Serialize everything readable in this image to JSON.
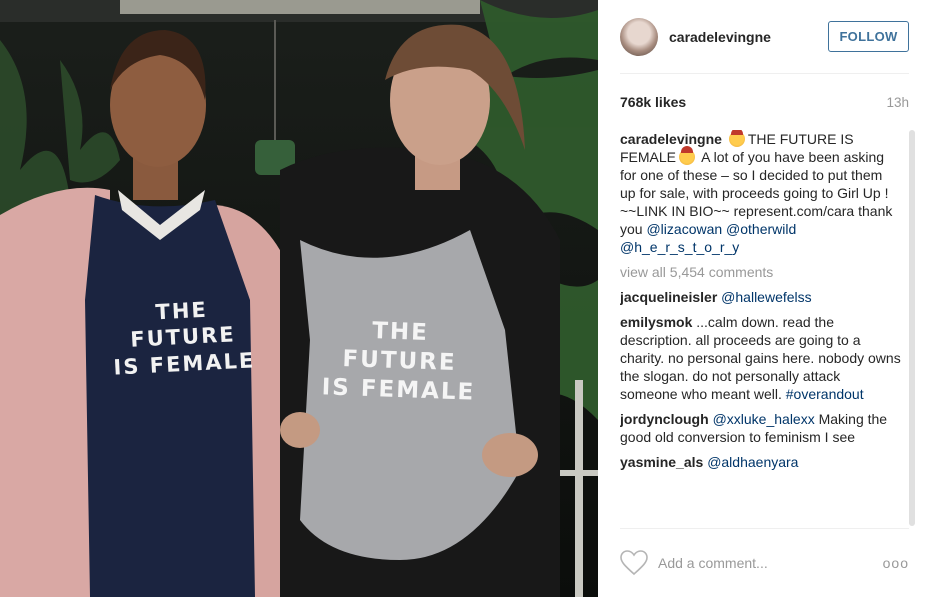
{
  "post": {
    "username": "caradelevingne",
    "follow_label": "FOLLOW",
    "likes": "768k likes",
    "time": "13h",
    "shirt_left": "THE FUTURE\nIS FEMALE",
    "shirt_right": "THE FUTURE\nIS FEMALE"
  },
  "caption": {
    "user": "caradelevingne",
    "text_1": "THE FUTURE IS FEMALE",
    "text_2": "A lot of you have been asking for one of these – so I decided to put them up for sale, with proceeds going to Girl Up ! ~~LINK IN BIO~~ represent.com/cara thank you",
    "mention_1": "@lizacowan",
    "mention_2": "@otherwild",
    "mention_3": "@h_e_r_s_t_o_r_y"
  },
  "view_all": "view all 5,454 comments",
  "comments": [
    {
      "user": "jacquelineisler",
      "mention": "@hallewefelss",
      "text": ""
    },
    {
      "user": "emilysmok",
      "mention": "",
      "text": "...calm down. read the description. all proceeds are going to a charity. no personal gains here. nobody owns the slogan. do not personally attack someone who meant well.",
      "tag": "#overandout"
    },
    {
      "user": "jordynclough",
      "mention": "@xxluke_halexx",
      "text": "Making the good old conversion to feminism I see"
    },
    {
      "user": "yasmine_als",
      "mention": "@aldhaenyara",
      "text": ""
    }
  ],
  "add_comment": {
    "placeholder": "Add a comment..."
  },
  "more_label": "ooo",
  "colors": {
    "link": "#003569",
    "follow": "#3f729b",
    "muted": "#999999"
  },
  "icons": {
    "heart": "heart-icon",
    "more": "more-options-icon"
  }
}
